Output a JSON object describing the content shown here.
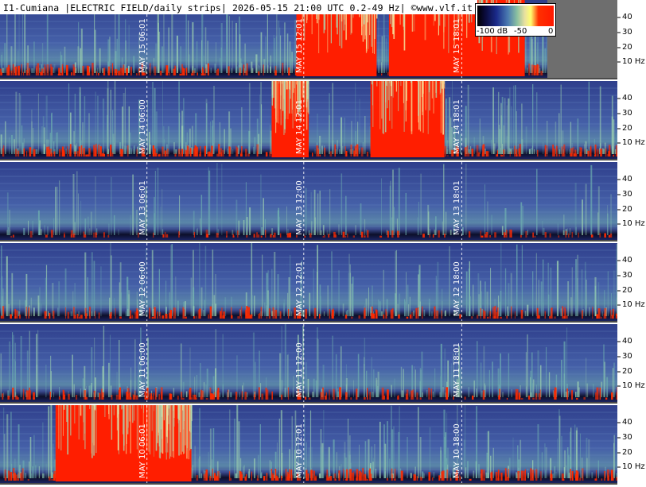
{
  "title": "I1-Cumiana |ELECTRIC FIELD/daily strips| 2026-05-15 21:00 UTC 0.2-49 Hz| ©www.vlf.it",
  "colorbar": {
    "labels": [
      "-100 dB",
      "-50",
      "0"
    ]
  },
  "chart_data": {
    "type": "heatmap",
    "title": "I1-Cumiana |ELECTRIC FIELD/daily strips| 2026-05-15 21:00 UTC 0.2-49 Hz| ©www.vlf.it",
    "ylabel_unit": "Hz",
    "y_ticks": [
      "40",
      "30",
      "20",
      "10 Hz"
    ],
    "scale": {
      "min_db": -100,
      "max_db": 0,
      "colormap": "black-blue-green-yellow-red"
    },
    "strips": [
      {
        "date_label": "MAY 15",
        "markers": [
          "MAY 15 06:01",
          "MAY 15 12:01",
          "MAY 15 18:01"
        ],
        "bursts": [
          [
            0.48,
            0.61
          ],
          [
            0.63,
            0.85
          ]
        ],
        "level": "high"
      },
      {
        "date_label": "MAY 14",
        "markers": [
          "MAY 14 06:00",
          "MAY 14 12:01",
          "MAY 14 18:01"
        ],
        "bursts": [
          [
            0.44,
            0.5
          ],
          [
            0.6,
            0.72
          ]
        ],
        "level": "high"
      },
      {
        "date_label": "MAY 13",
        "markers": [
          "MAY 13 06:01",
          "MAY 13 12:00",
          "MAY 13 18:01"
        ],
        "bursts": [],
        "level": "low"
      },
      {
        "date_label": "MAY 12",
        "markers": [
          "MAY 12 06:00",
          "MAY 12 12:01",
          "MAY 12 18:00"
        ],
        "bursts": [],
        "level": "medium"
      },
      {
        "date_label": "MAY 11",
        "markers": [
          "MAY 11 06:00",
          "MAY 11 12:00",
          "MAY 11 18:01"
        ],
        "bursts": [],
        "level": "medium"
      },
      {
        "date_label": "MAY 10",
        "markers": [
          "MAY 10 06:01",
          "MAY 10 12:01",
          "MAY 10 18:00"
        ],
        "bursts": [
          [
            0.09,
            0.25
          ],
          [
            0.25,
            0.31
          ]
        ],
        "level": "high"
      }
    ]
  },
  "colors": {
    "background_blue": "#3a4e9a",
    "noise_green": "#9fd4b0",
    "burst_red": "#ff1e00",
    "separator": "#4a4a4a",
    "axis_bg": "#ffffff"
  }
}
